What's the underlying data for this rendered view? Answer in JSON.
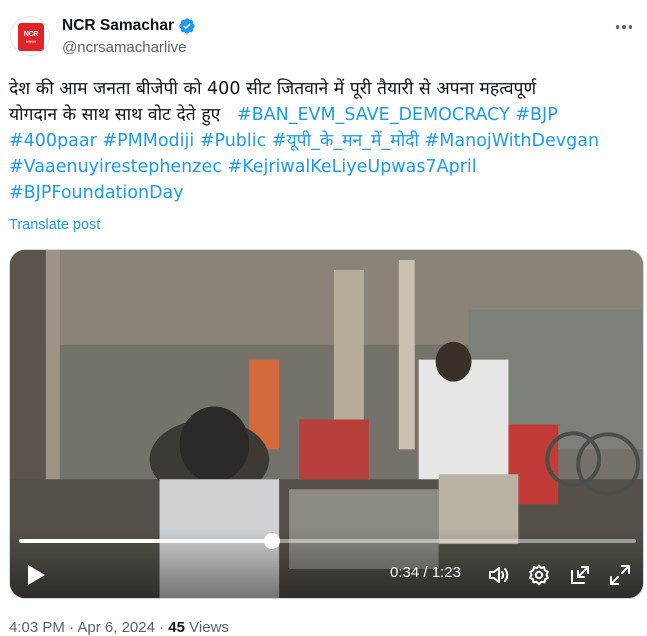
{
  "account": {
    "display_name": "NCR Samachar",
    "handle": "@ncrsamacharlive",
    "logo_text": "NCR",
    "logo_subtext": "समाचार",
    "verified": true,
    "verified_color": "#1d9bf0",
    "logo_color": "#e0242a"
  },
  "more_icon": "more-horizontal-icon",
  "post": {
    "text_line1": "देश की आम जनता बीजेपी को 400 सीट जितवाने में पूरी तैयारी से अपना महत्वपूर्ण",
    "text_line2_plain": "योगदान के साथ साथ वोट देते हुए",
    "hashtags": {
      "ban_evm": "#BAN_EVM_SAVE_DEMOCRACY",
      "bjp": "#BJP",
      "paar": "#400paar",
      "pmmodiji": "#PMModiji",
      "public": "#Public",
      "upi": "#यूपी_के_मन_में_मोदी",
      "manoj": "#ManojWithDevgan",
      "vaaenu": "#Vaaenuyirestephenzec",
      "kejriwal": "#KejriwalKeLiyeUpwas7April",
      "foundation": "#BJPFoundationDay"
    },
    "translate_label": "Translate post",
    "link_color": "#1d9bf0"
  },
  "video": {
    "current_time": "0:34",
    "duration": "1:23",
    "time_separator": " / ",
    "progress_fraction": 0.41,
    "icons": [
      "play-icon",
      "volume-icon",
      "settings-gear-icon",
      "popout-icon",
      "fullscreen-icon"
    ]
  },
  "meta": {
    "time": "4:03 PM",
    "separator": "·",
    "date": "Apr 6, 2024",
    "views_count": "45",
    "views_label": "Views"
  }
}
